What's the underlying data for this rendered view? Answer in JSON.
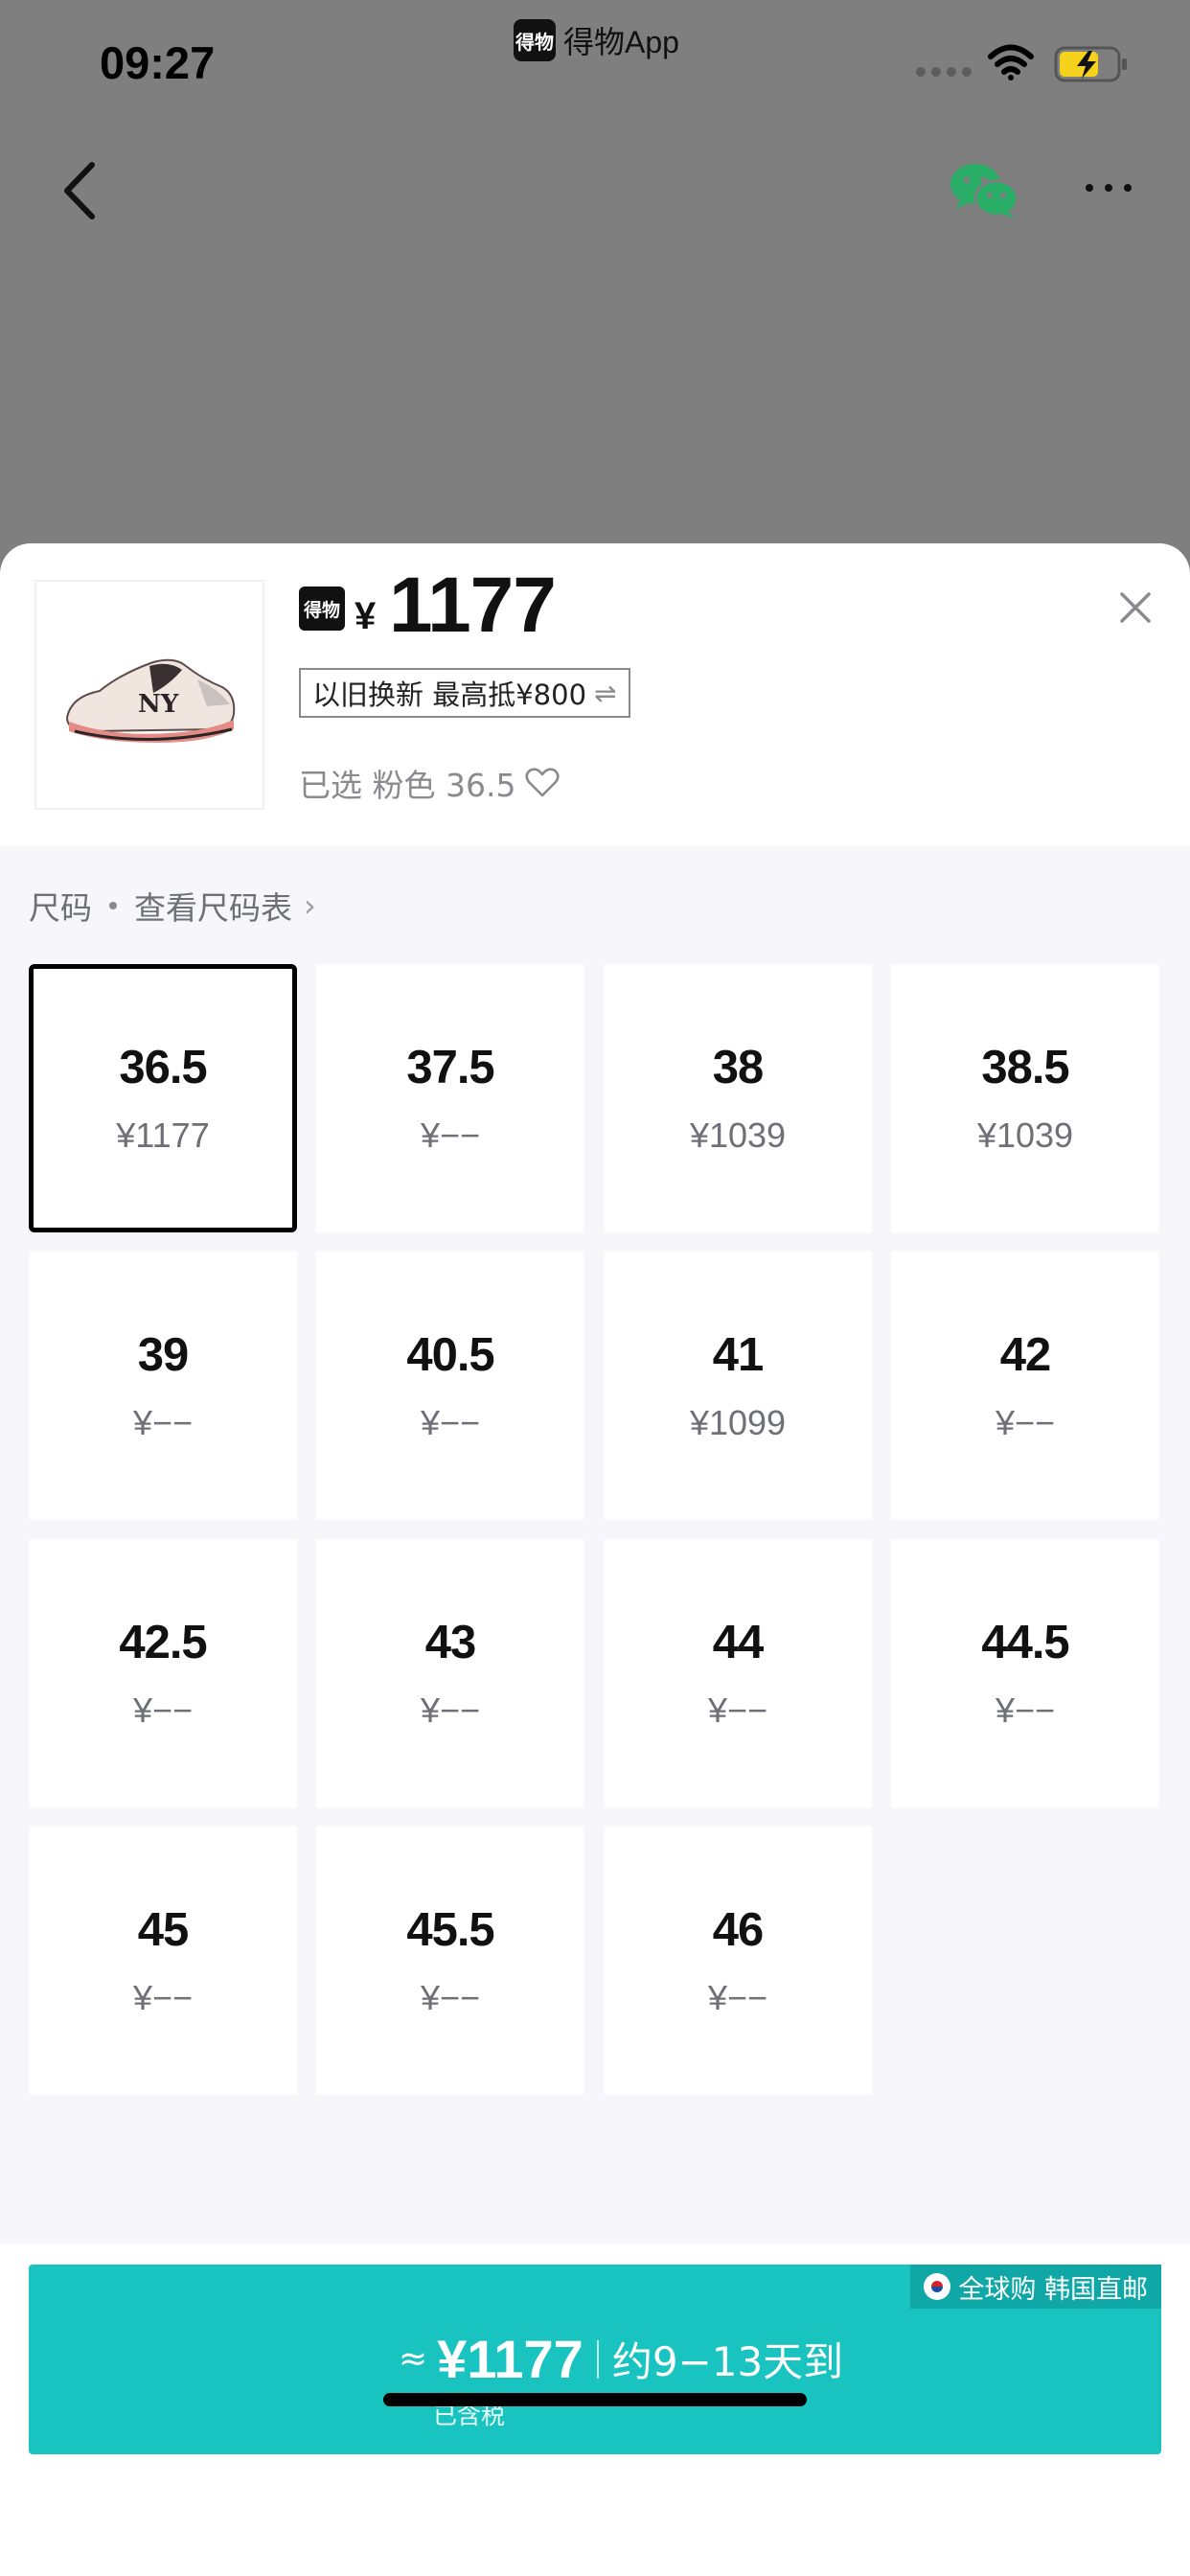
{
  "status_bar": {
    "time": "09:27",
    "app_logo_text": "得物",
    "app_name": "得物App"
  },
  "product": {
    "brand_logo_text": "得物",
    "currency": "¥",
    "price": "1177",
    "tradein": "以旧换新 最高抵¥800",
    "tradein_icon": "⇌",
    "selected_text": "已选 粉色 36.5"
  },
  "size_section": {
    "title": "尺码",
    "chart_link": "查看尺码表",
    "sizes": [
      {
        "size": "36.5",
        "price": "¥1177",
        "selected": true
      },
      {
        "size": "37.5",
        "price": "¥−−"
      },
      {
        "size": "38",
        "price": "¥1039"
      },
      {
        "size": "38.5",
        "price": "¥1039"
      },
      {
        "size": "39",
        "price": "¥−−"
      },
      {
        "size": "40.5",
        "price": "¥−−"
      },
      {
        "size": "41",
        "price": "¥1099"
      },
      {
        "size": "42",
        "price": "¥−−"
      },
      {
        "size": "42.5",
        "price": "¥−−"
      },
      {
        "size": "43",
        "price": "¥−−"
      },
      {
        "size": "44",
        "price": "¥−−"
      },
      {
        "size": "44.5",
        "price": "¥−−"
      },
      {
        "size": "45",
        "price": "¥−−"
      },
      {
        "size": "45.5",
        "price": "¥−−"
      },
      {
        "size": "46",
        "price": "¥−−"
      }
    ]
  },
  "buy_button": {
    "global_tag": "全球购 韩国直邮",
    "approx": "≈",
    "price": "¥1177",
    "eta": "约9−13天到",
    "tax_note": "已含税",
    "color": "#19c3c0"
  },
  "colors": {
    "accent": "#19c3c0",
    "wechat": "#2aae67",
    "battery": "#f7d21c"
  }
}
